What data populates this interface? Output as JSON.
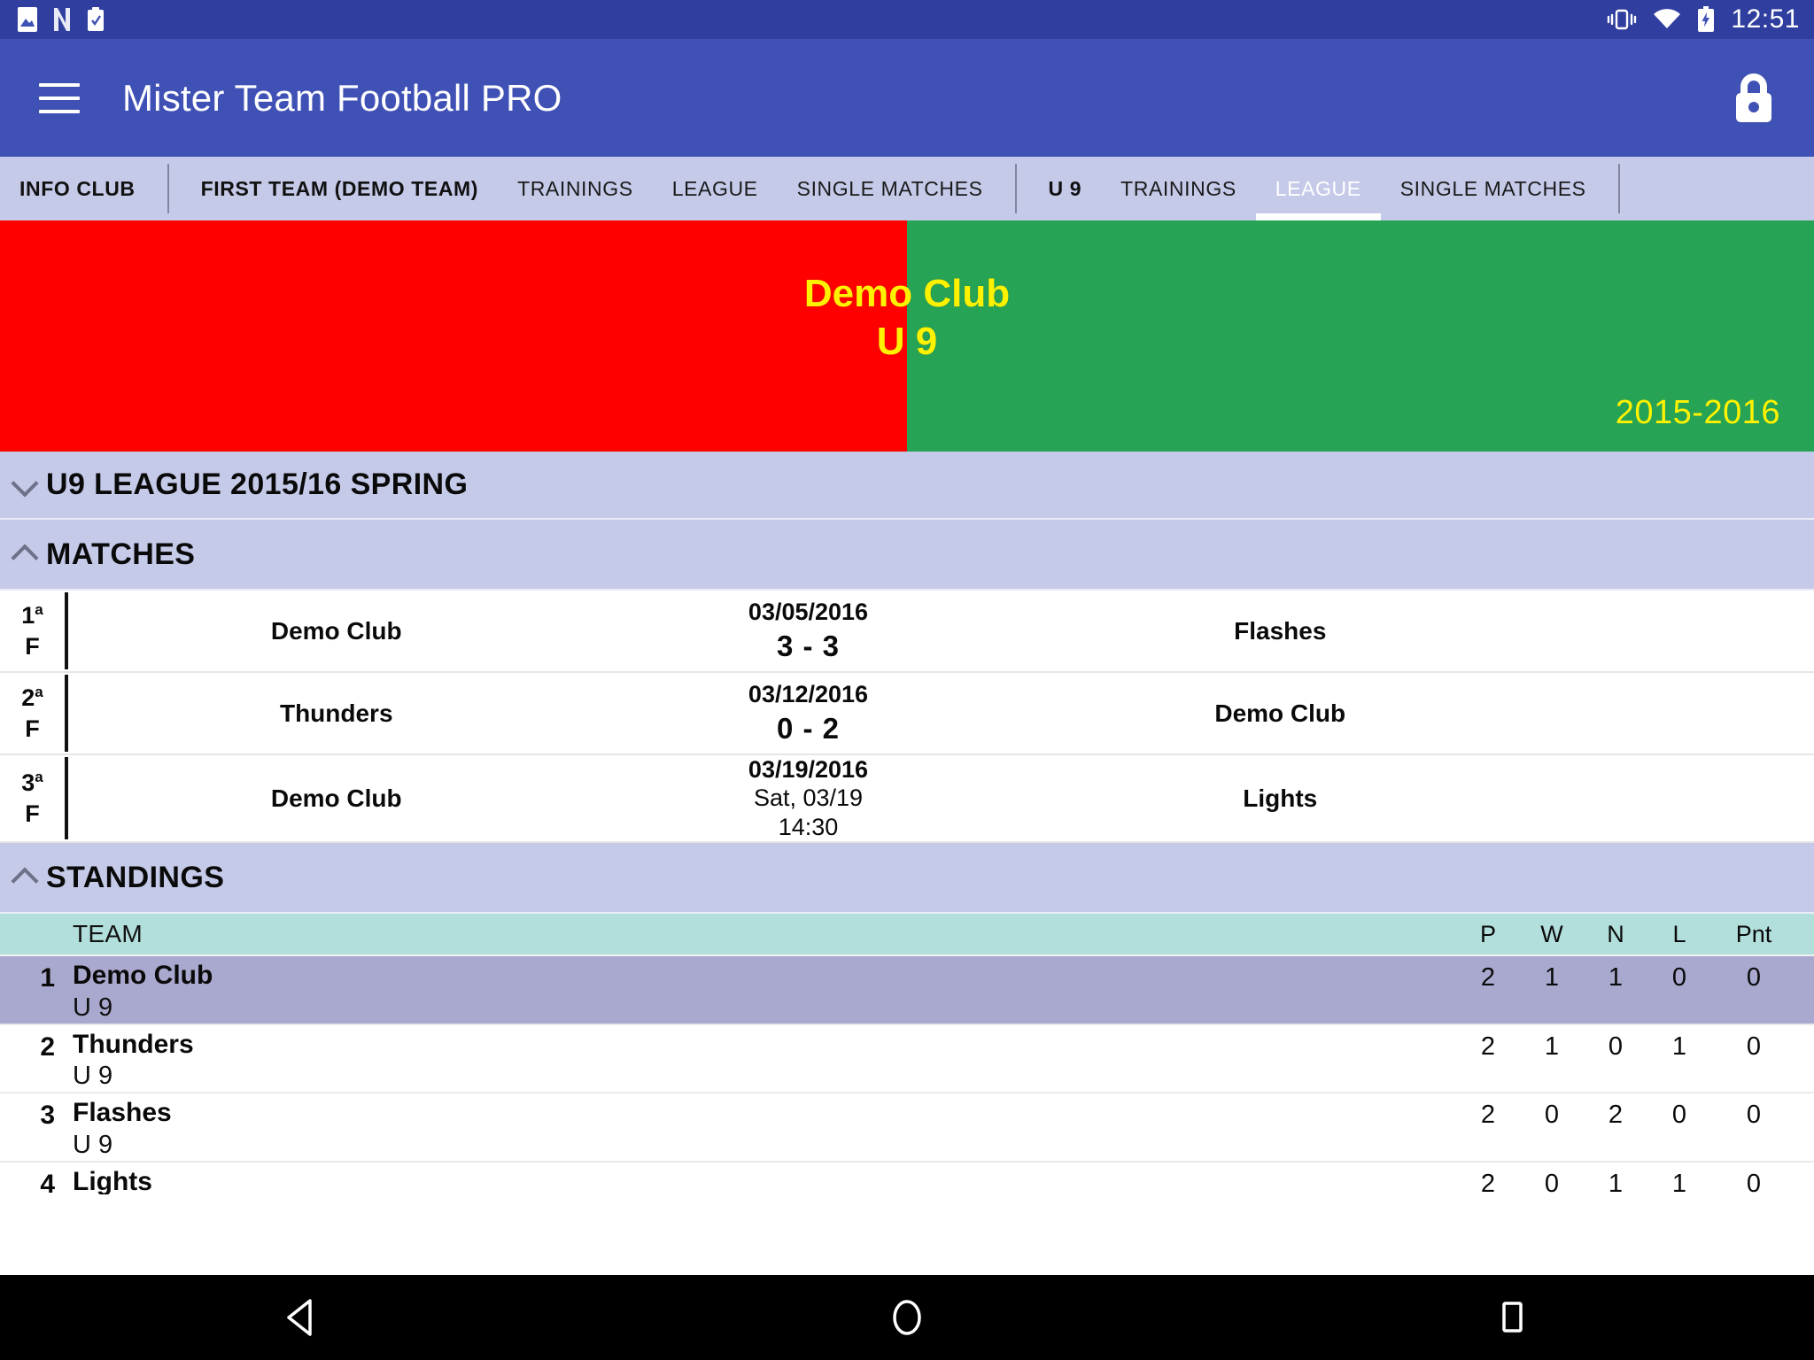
{
  "status_bar": {
    "time": "12:51",
    "icons": [
      "image-icon",
      "n-app-icon",
      "clipboard-check-icon",
      "vibrate-icon",
      "wifi-icon",
      "battery-charging-icon"
    ]
  },
  "app_bar": {
    "title": "Mister Team Football PRO",
    "menu_icon": "hamburger-menu-icon",
    "lock_icon": "lock-icon",
    "background": "#3F51B5"
  },
  "tabs": [
    {
      "label": "INFO CLUB",
      "bold": true,
      "active": false
    },
    {
      "label": "FIRST TEAM (DEMO TEAM)",
      "bold": true,
      "active": false
    },
    {
      "label": "TRAININGS",
      "bold": false,
      "active": false
    },
    {
      "label": "LEAGUE",
      "bold": false,
      "active": false
    },
    {
      "label": "SINGLE MATCHES",
      "bold": false,
      "active": false
    },
    {
      "label": "U 9",
      "bold": true,
      "active": false
    },
    {
      "label": "TRAININGS",
      "bold": false,
      "active": false
    },
    {
      "label": "LEAGUE",
      "bold": false,
      "active": true
    },
    {
      "label": "SINGLE MATCHES",
      "bold": false,
      "active": false
    }
  ],
  "banner": {
    "club_name": "Demo Club",
    "category": "U 9",
    "season": "2015-2016",
    "red": "#FF0000",
    "green": "#27A355",
    "text_color": "#FFF200"
  },
  "league_header": {
    "title": "U9 LEAGUE 2015/16 SPRING",
    "chevron": "chevron-down-icon"
  },
  "matches_section": {
    "title": "MATCHES",
    "chevron": "chevron-up-icon",
    "rows": [
      {
        "round": "1",
        "round_sup": "a",
        "round_type": "F",
        "home": "Demo Club",
        "date": "03/05/2016",
        "score": "3 - 3",
        "sub1": "",
        "sub2": "",
        "away": "Flashes"
      },
      {
        "round": "2",
        "round_sup": "a",
        "round_type": "F",
        "home": "Thunders",
        "date": "03/12/2016",
        "score": "0 - 2",
        "sub1": "",
        "sub2": "",
        "away": "Demo Club"
      },
      {
        "round": "3",
        "round_sup": "a",
        "round_type": "F",
        "home": "Demo Club",
        "date": "03/19/2016",
        "score": "",
        "sub1": "Sat, 03/19",
        "sub2": "14:30",
        "away": "Lights"
      }
    ]
  },
  "standings_section": {
    "title": "STANDINGS",
    "chevron": "chevron-up-icon",
    "columns": {
      "team": "TEAM",
      "p": "P",
      "w": "W",
      "n": "N",
      "l": "L",
      "pnt": "Pnt"
    },
    "rows": [
      {
        "pos": "1",
        "team": "Demo Club",
        "category": "U 9",
        "p": "2",
        "w": "1",
        "n": "1",
        "l": "0",
        "pnt": "0",
        "highlighted": true
      },
      {
        "pos": "2",
        "team": "Thunders",
        "category": "U 9",
        "p": "2",
        "w": "1",
        "n": "0",
        "l": "1",
        "pnt": "0",
        "highlighted": false
      },
      {
        "pos": "3",
        "team": "Flashes",
        "category": "U 9",
        "p": "2",
        "w": "0",
        "n": "2",
        "l": "0",
        "pnt": "0",
        "highlighted": false
      },
      {
        "pos": "4",
        "team": "Lights",
        "category": "",
        "p": "2",
        "w": "0",
        "n": "1",
        "l": "1",
        "pnt": "0",
        "highlighted": false
      }
    ]
  },
  "nav_bar": {
    "back": "back-triangle-icon",
    "home": "home-circle-icon",
    "recents": "recents-square-icon"
  }
}
